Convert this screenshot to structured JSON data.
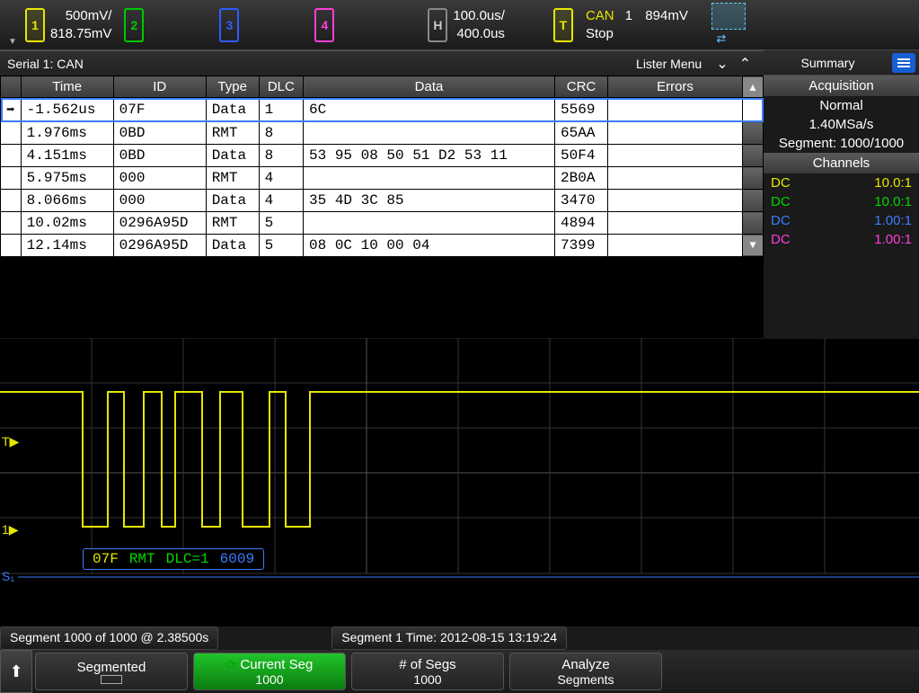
{
  "topbar": {
    "ch1_top": "500mV/",
    "ch1_bot": "818.75mV",
    "h_top": "100.0us/",
    "h_bot": "400.0us",
    "can_label": "CAN",
    "can_num": "1",
    "can_volt": "894mV",
    "stop": "Stop"
  },
  "lister": {
    "title": "Serial 1: CAN",
    "menu_label": "Lister Menu",
    "columns": {
      "time": "Time",
      "id": "ID",
      "type": "Type",
      "dlc": "DLC",
      "data": "Data",
      "crc": "CRC",
      "errors": "Errors"
    },
    "rows": [
      {
        "time": "-1.562us",
        "id": "07F",
        "type": "Data",
        "dlc": "1",
        "data": "6C",
        "crc": "5569",
        "errors": ""
      },
      {
        "time": "1.976ms",
        "id": "0BD",
        "type": "RMT",
        "dlc": "8",
        "data": "",
        "crc": "65AA",
        "errors": ""
      },
      {
        "time": "4.151ms",
        "id": "0BD",
        "type": "Data",
        "dlc": "8",
        "data": "53 95 08 50 51 D2 53 11",
        "crc": "50F4",
        "errors": ""
      },
      {
        "time": "5.975ms",
        "id": "000",
        "type": "RMT",
        "dlc": "4",
        "data": "",
        "crc": "2B0A",
        "errors": ""
      },
      {
        "time": "8.066ms",
        "id": "000",
        "type": "Data",
        "dlc": "4",
        "data": "35 4D 3C 85",
        "crc": "3470",
        "errors": ""
      },
      {
        "time": "10.02ms",
        "id": "0296A95D",
        "type": "RMT",
        "dlc": "5",
        "data": "",
        "crc": "4894",
        "errors": ""
      },
      {
        "time": "12.14ms",
        "id": "0296A95D",
        "type": "Data",
        "dlc": "5",
        "data": "08 0C 10 00 04",
        "crc": "7399",
        "errors": ""
      }
    ]
  },
  "sidebar": {
    "summary": "Summary",
    "acquisition": "Acquisition",
    "mode": "Normal",
    "rate": "1.40MSa/s",
    "segment": "Segment: 1000/1000",
    "channels": "Channels",
    "ch": [
      {
        "label": "DC",
        "val": "10.0:1",
        "color": "c-yellow"
      },
      {
        "label": "DC",
        "val": "10.0:1",
        "color": "c-green"
      },
      {
        "label": "DC",
        "val": "1.00:1",
        "color": "c-blue"
      },
      {
        "label": "DC",
        "val": "1.00:1",
        "color": "c-pink"
      }
    ]
  },
  "decode": {
    "id": "07F",
    "type": "RMT",
    "dlc": "DLC=1",
    "crc": "6009"
  },
  "status": {
    "left": "Segment 1000 of 1000 @ 2.38500s",
    "right": "Segment 1 Time: 2012-08-15 13:19:24"
  },
  "softkeys": {
    "k1": "Segmented",
    "k2_top": "Current Seg",
    "k2_bot": "1000",
    "k3_top": "# of Segs",
    "k3_bot": "1000",
    "k4_top": "Analyze",
    "k4_bot": "Segments"
  }
}
